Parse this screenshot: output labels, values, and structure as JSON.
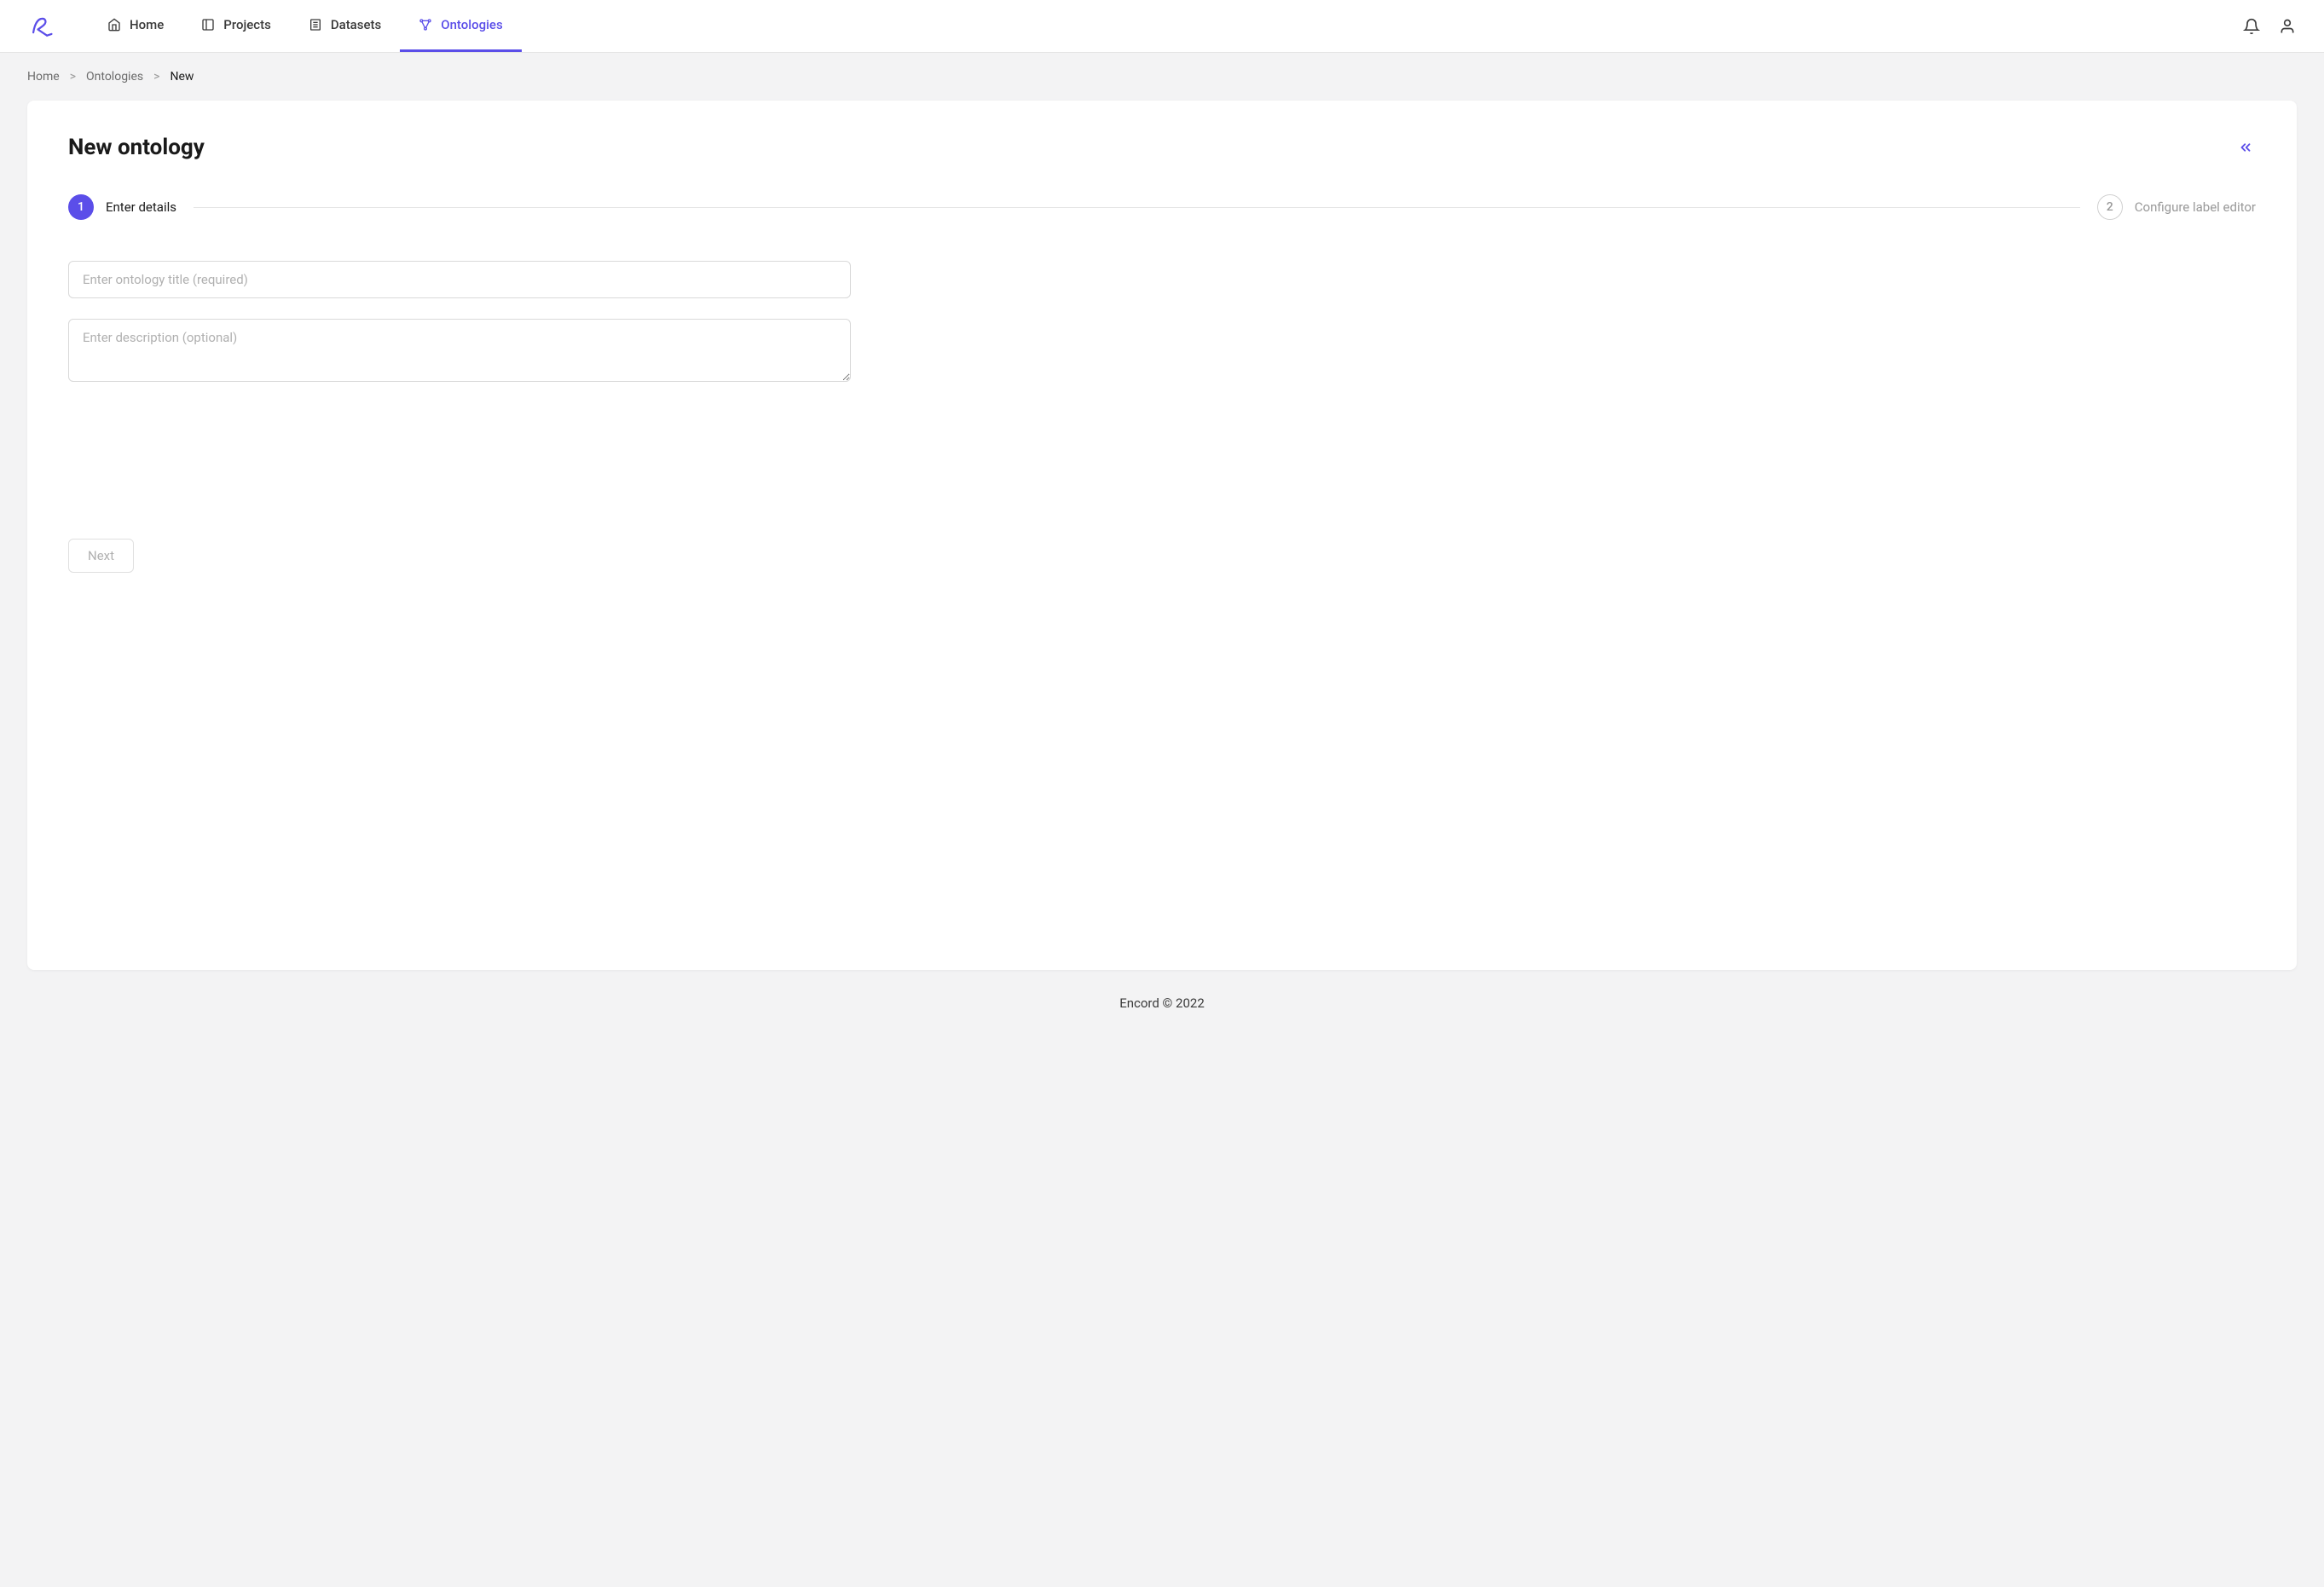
{
  "nav": {
    "items": [
      {
        "label": "Home",
        "active": false
      },
      {
        "label": "Projects",
        "active": false
      },
      {
        "label": "Datasets",
        "active": false
      },
      {
        "label": "Ontologies",
        "active": true
      }
    ]
  },
  "breadcrumb": {
    "items": [
      "Home",
      "Ontologies",
      "New"
    ]
  },
  "page": {
    "title": "New ontology"
  },
  "steps": {
    "step1": {
      "number": "1",
      "label": "Enter details"
    },
    "step2": {
      "number": "2",
      "label": "Configure label editor"
    }
  },
  "form": {
    "title_placeholder": "Enter ontology title (required)",
    "description_placeholder": "Enter description (optional)",
    "next_label": "Next"
  },
  "footer": {
    "text": "Encord © 2022"
  }
}
